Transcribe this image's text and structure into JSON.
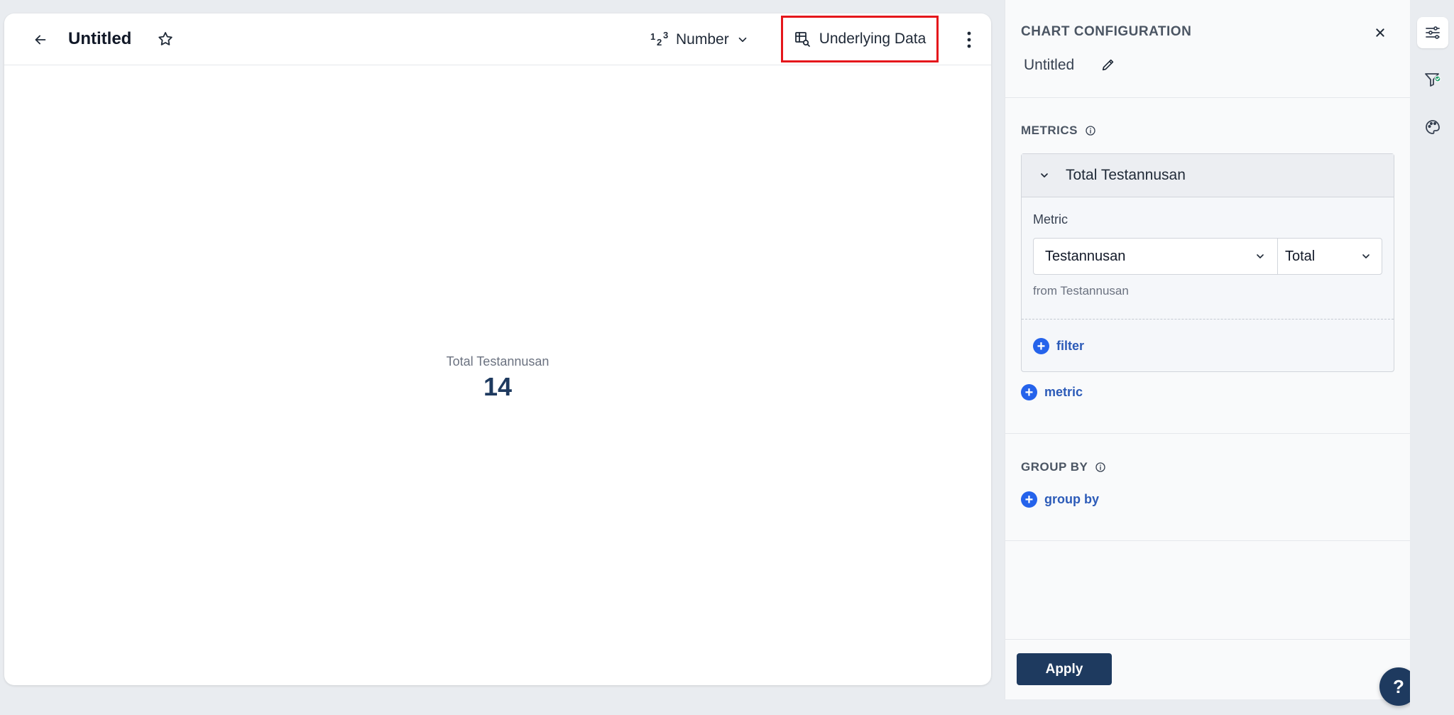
{
  "header": {
    "title": "Untitled",
    "chart_type": "Number",
    "chart_type_icon_superscript": "1",
    "chart_type_icon_sub": "2",
    "chart_type_icon_sup2": "3",
    "underlying_data_label": "Underlying Data"
  },
  "chart": {
    "label": "Total Testannusan",
    "value": "14"
  },
  "panel": {
    "title": "CHART CONFIGURATION",
    "chart_name": "Untitled",
    "metrics_label": "METRICS",
    "metric": {
      "name": "Total Testannusan",
      "field_label": "Metric",
      "field_value": "Testannusan",
      "aggregation": "Total",
      "from_text": "from Testannusan",
      "add_filter_label": "filter"
    },
    "add_metric_label": "metric",
    "group_by_label": "GROUP BY",
    "add_group_by_label": "group by",
    "apply_label": "Apply"
  },
  "help": {
    "label": "?"
  },
  "icons": {
    "back": "arrow-left-icon",
    "star": "star-icon",
    "number": "number-type-icon",
    "chevron": "chevron-down-icon",
    "table_search": "table-search-icon",
    "more": "more-vertical-icon",
    "close": "close-icon",
    "edit": "pencil-icon",
    "info": "info-icon",
    "plus": "plus-circle-icon",
    "sliders": "sliders-icon",
    "filter": "filter-check-icon",
    "palette": "palette-icon"
  },
  "colors": {
    "highlight": "#e5161b",
    "primary_dark": "#1e3a5f",
    "link_blue": "#2c5bb8",
    "plus_blue": "#2563eb",
    "check_green": "#22a06b"
  }
}
